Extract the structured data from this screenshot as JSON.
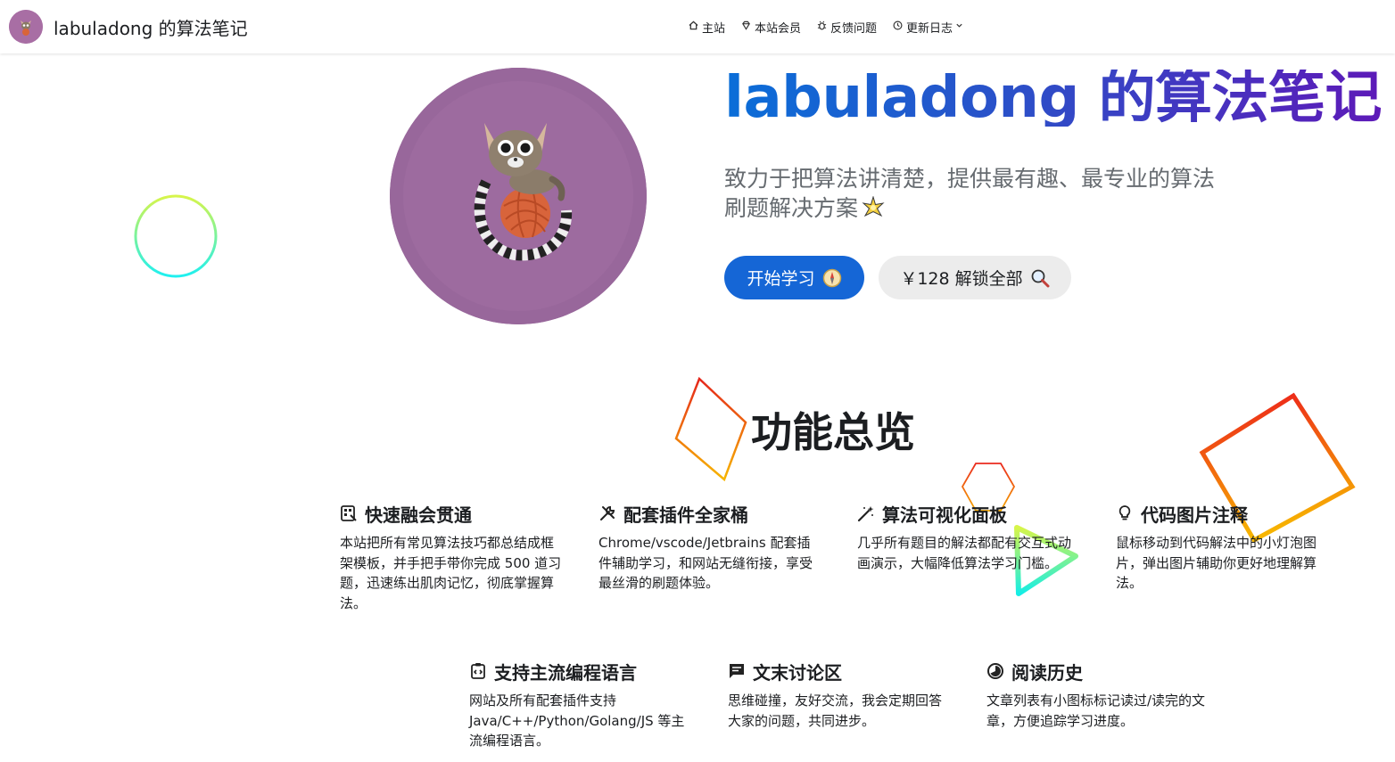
{
  "nav": {
    "brand_title": "labuladong 的算法笔记",
    "links": [
      {
        "label": "主站",
        "icon": "home-icon"
      },
      {
        "label": "本站会员",
        "icon": "diamond-icon"
      },
      {
        "label": "反馈问题",
        "icon": "bug-icon"
      },
      {
        "label": "更新日志",
        "icon": "log-icon"
      }
    ]
  },
  "hero": {
    "title": "labuladong 的算法笔记",
    "subtitle": "致力于把算法讲清楚，提供最有趣、最专业的算法刷题解决方案",
    "primary_button": "开始学习",
    "secondary_button": "￥128 解锁全部"
  },
  "features": {
    "section_title": "功能总览",
    "items": [
      {
        "title": "快速融会贯通",
        "desc": "本站把所有常见算法技巧都总结成框架模板，并手把手带你完成 500 道习题，迅速练出肌肉记忆，彻底掌握算法。",
        "icon": "template-icon"
      },
      {
        "title": "配套插件全家桶",
        "desc": "Chrome/vscode/Jetbrains 配套插件辅助学习，和网站无缝衔接，享受最丝滑的刷题体验。",
        "icon": "tools-icon"
      },
      {
        "title": "算法可视化面板",
        "desc": "几乎所有题目的解法都配有交互式动画演示，大幅降低算法学习门槛。",
        "icon": "magic-wand-icon"
      },
      {
        "title": "代码图片注释",
        "desc": "鼠标移动到代码解法中的小灯泡图片，弹出图片辅助你更好地理解算法。",
        "icon": "lightbulb-icon"
      },
      {
        "title": "支持主流编程语言",
        "desc": "网站及所有配套插件支持 Java/C++/Python/Golang/JS 等主流编程语言。",
        "icon": "code-file-icon"
      },
      {
        "title": "文末讨论区",
        "desc": "思维碰撞，友好交流，我会定期回答大家的问题，共同进步。",
        "icon": "comment-icon"
      },
      {
        "title": "阅读历史",
        "desc": "文章列表有小图标标记读过/读完的文章，方便追踪学习进度。",
        "icon": "progress-icon"
      }
    ]
  },
  "colors": {
    "primary": "#1566d6",
    "title_gradient_start": "#0a6ed8",
    "title_gradient_end": "#5d1ab8",
    "avatar_bg": "#a879a8"
  }
}
